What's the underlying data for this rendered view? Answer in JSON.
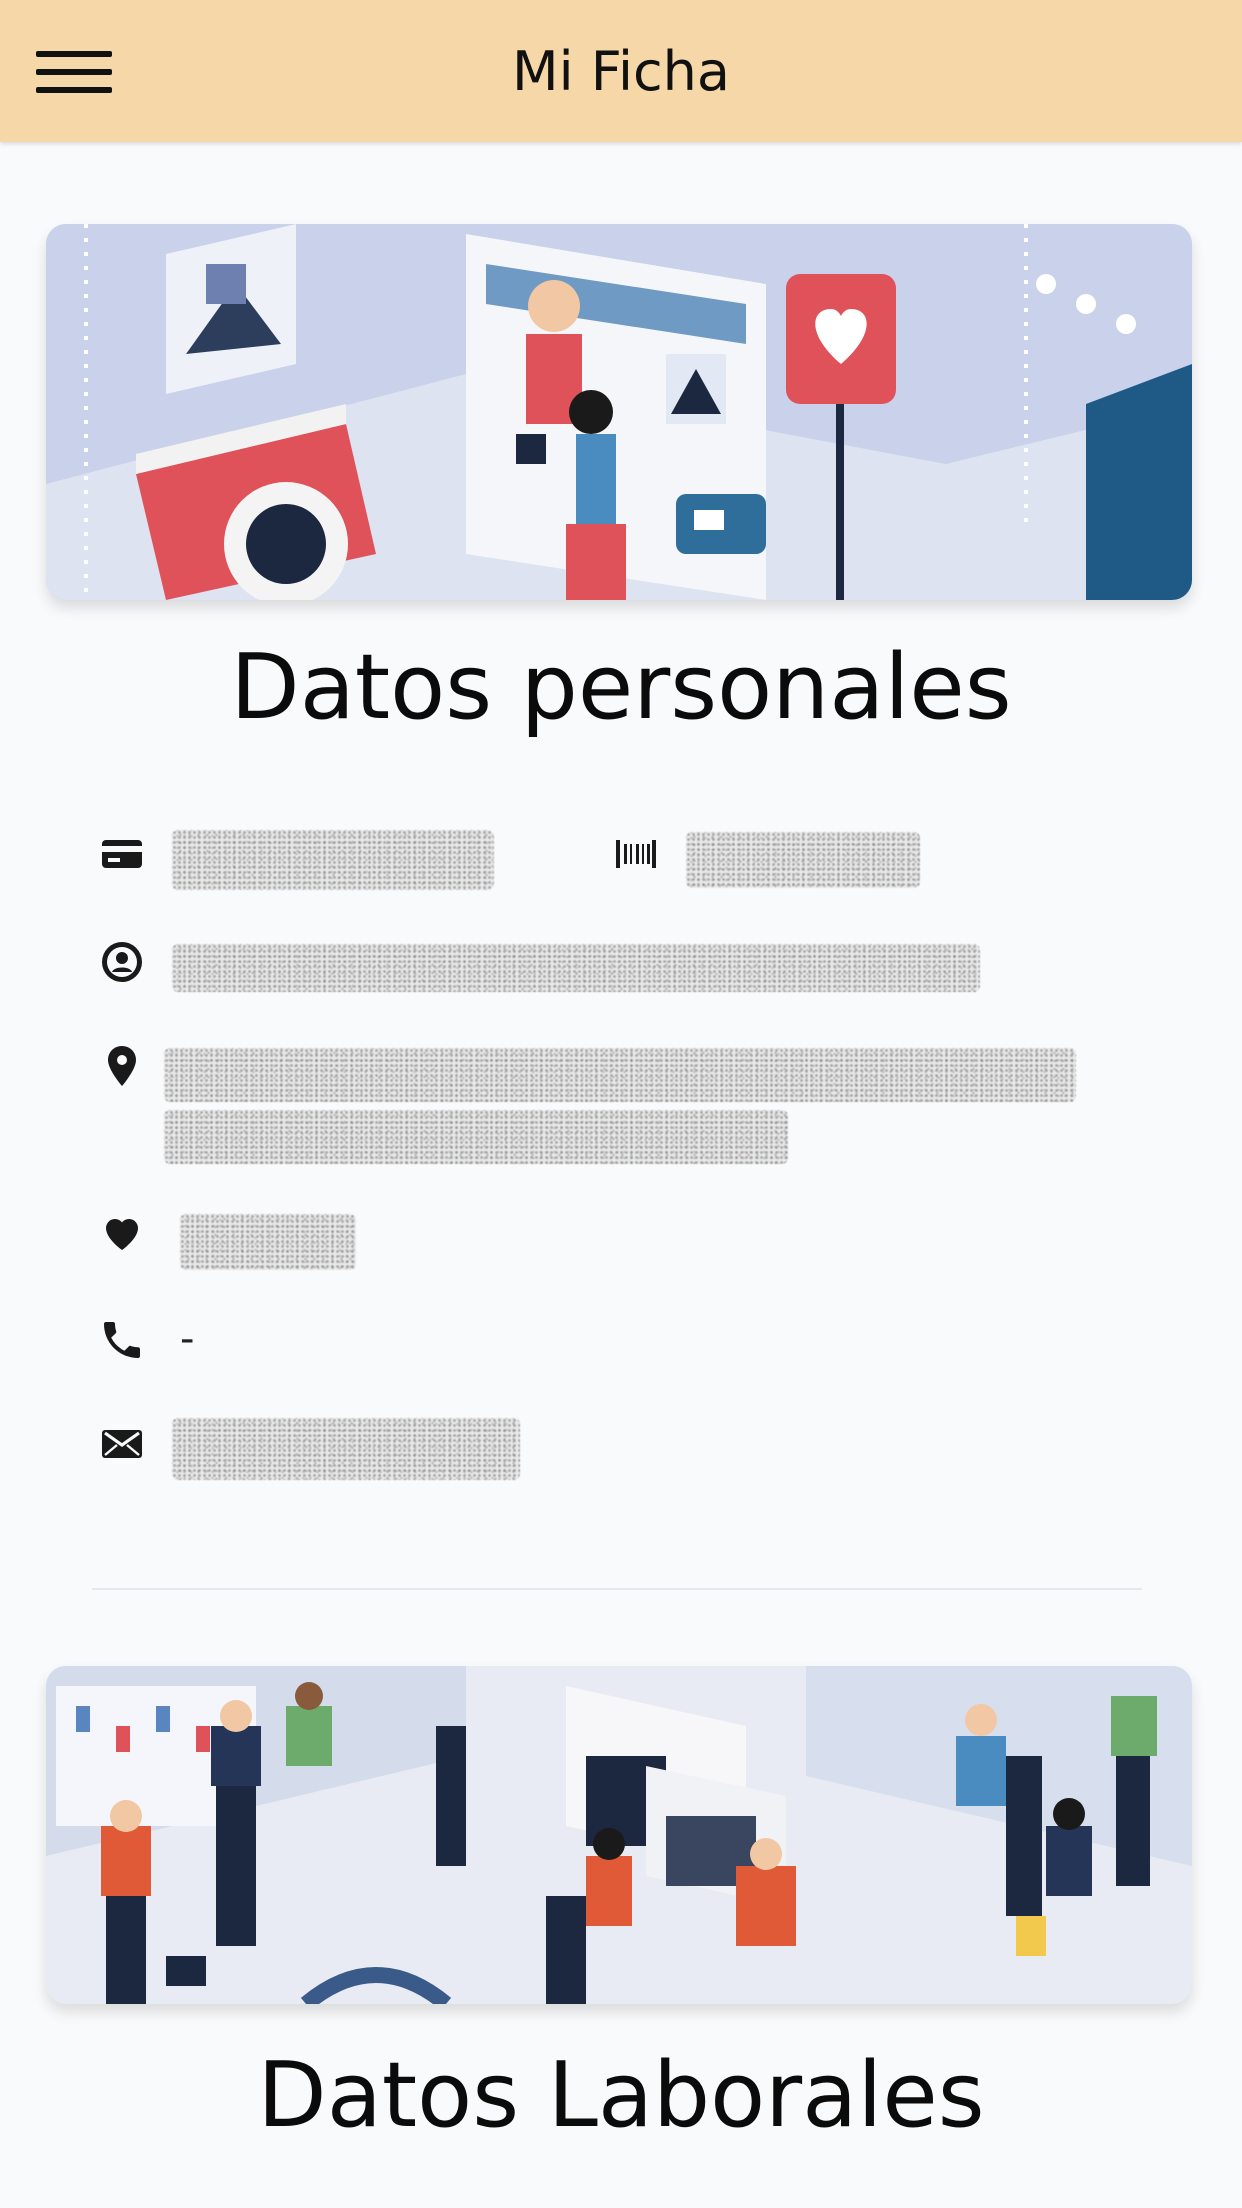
{
  "appbar": {
    "title": "Mi Ficha",
    "menu_icon": "hamburger-menu-icon"
  },
  "sections": {
    "personal_title": "Datos personales",
    "work_title": "Datos Laborales"
  },
  "personal": {
    "id_card_icon": "id-card-icon",
    "barcode_icon": "barcode-icon",
    "person_icon": "person-icon",
    "location_icon": "location-pin-icon",
    "heart_icon": "heart-icon",
    "phone_icon": "phone-icon",
    "mail_icon": "mail-icon",
    "phone_value": "-"
  },
  "colors": {
    "appbar_background": "#f6d7a7",
    "page_background": "#f9fafb",
    "icon_color": "#1a1a1a"
  }
}
